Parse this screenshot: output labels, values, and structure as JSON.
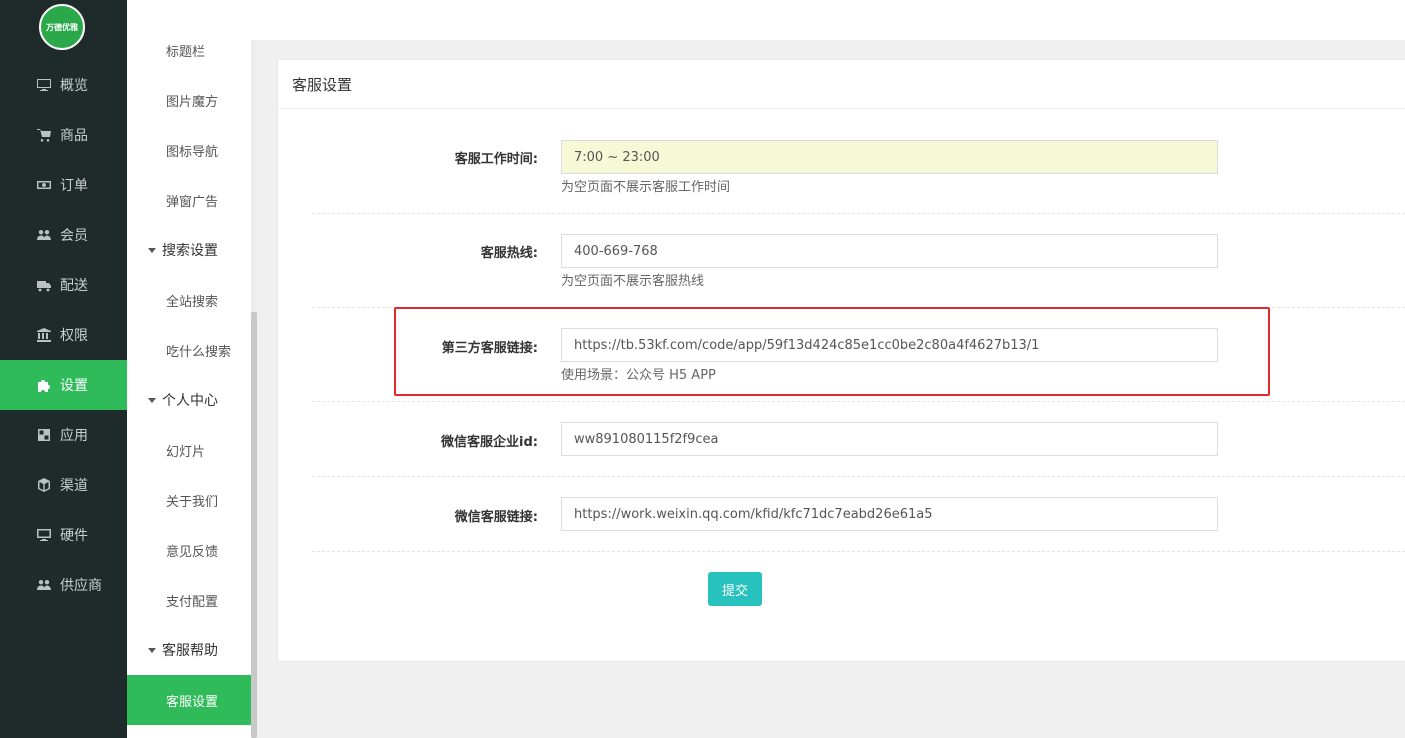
{
  "logo": {
    "text": "万德优雅"
  },
  "nav": {
    "items": [
      {
        "label": "概览",
        "icon": "monitor-icon"
      },
      {
        "label": "商品",
        "icon": "cart-icon"
      },
      {
        "label": "订单",
        "icon": "money-icon"
      },
      {
        "label": "会员",
        "icon": "users-icon"
      },
      {
        "label": "配送",
        "icon": "truck-icon"
      },
      {
        "label": "权限",
        "icon": "bank-icon"
      },
      {
        "label": "设置",
        "icon": "puzzle-icon",
        "active": true
      },
      {
        "label": "应用",
        "icon": "apps-icon"
      },
      {
        "label": "渠道",
        "icon": "cube-icon"
      },
      {
        "label": "硬件",
        "icon": "desktop-icon"
      },
      {
        "label": "供应商",
        "icon": "users-icon"
      }
    ]
  },
  "subnav": {
    "items": [
      {
        "label": "标题栏",
        "type": "item"
      },
      {
        "label": "图片魔方",
        "type": "item"
      },
      {
        "label": "图标导航",
        "type": "item"
      },
      {
        "label": "弹窗广告",
        "type": "item"
      },
      {
        "label": "搜索设置",
        "type": "group"
      },
      {
        "label": "全站搜索",
        "type": "item"
      },
      {
        "label": "吃什么搜索",
        "type": "item"
      },
      {
        "label": "个人中心",
        "type": "group"
      },
      {
        "label": "幻灯片",
        "type": "item"
      },
      {
        "label": "关于我们",
        "type": "item"
      },
      {
        "label": "意见反馈",
        "type": "item"
      },
      {
        "label": "支付配置",
        "type": "item"
      },
      {
        "label": "客服帮助",
        "type": "group"
      },
      {
        "label": "客服设置",
        "type": "item",
        "active": true
      }
    ]
  },
  "panel": {
    "title": "客服设置",
    "fields": [
      {
        "label": "客服工作时间:",
        "value": "7:00 ~ 23:00",
        "help": "为空页面不展示客服工作时间"
      },
      {
        "label": "客服热线:",
        "value": "400-669-768",
        "help": "为空页面不展示客服热线"
      },
      {
        "label": "第三方客服链接:",
        "value": "https://tb.53kf.com/code/app/59f13d424c85e1cc0be2c80a4f4627b13/1",
        "help": "使用场景：公众号 H5 APP"
      },
      {
        "label": "微信客服企业id:",
        "value": "ww891080115f2f9cea",
        "help": ""
      },
      {
        "label": "微信客服链接:",
        "value": "https://work.weixin.qq.com/kfid/kfc71dc7eabd26e61a5",
        "help": ""
      }
    ],
    "submit_label": "提交"
  },
  "colors": {
    "accent": "#2fbb5a",
    "nav_bg": "#1f2a2a",
    "button": "#27c2be",
    "highlight": "#e02a2a"
  }
}
